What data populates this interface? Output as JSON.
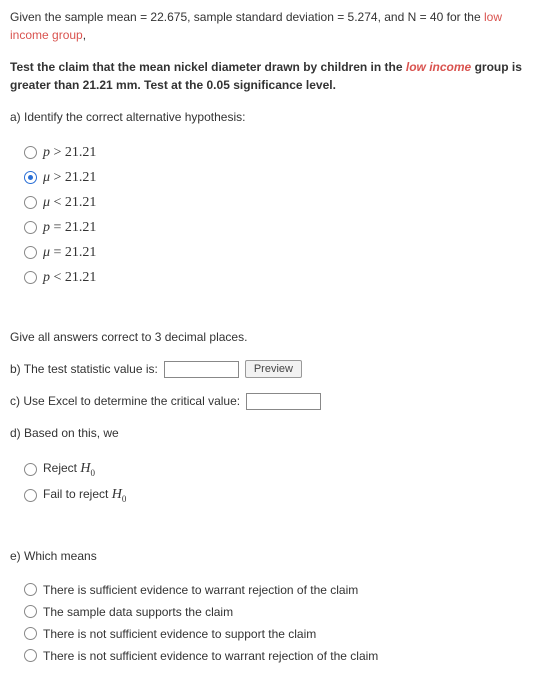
{
  "intro1_a": "Given the sample mean = 22.675, sample standard deviation = 5.274, and N = 40 for the ",
  "intro1_b": "low income group",
  "intro1_c": ",",
  "intro2_a": "Test the claim that the mean nickel diameter drawn by children in the ",
  "intro2_b": "low income",
  "intro2_c": " group is greater than 21.21 mm. Test at the 0.05 significance level.",
  "qa": "a) Identify the correct alternative hypothesis:",
  "opts_a": [
    {
      "sym": "p",
      "op": ">",
      "v": "21.21",
      "sel": false
    },
    {
      "sym": "μ",
      "op": ">",
      "v": "21.21",
      "sel": true
    },
    {
      "sym": "μ",
      "op": "<",
      "v": "21.21",
      "sel": false
    },
    {
      "sym": "p",
      "op": "=",
      "v": "21.21",
      "sel": false
    },
    {
      "sym": "μ",
      "op": "=",
      "v": "21.21",
      "sel": false
    },
    {
      "sym": "p",
      "op": "<",
      "v": "21.21",
      "sel": false
    }
  ],
  "note3dec": "Give all answers correct to 3 decimal places.",
  "qb": "b) The test statistic value is:",
  "preview": "Preview",
  "qc": "c) Use Excel to determine the critical value:",
  "qd": "d) Based on this, we",
  "opts_d": [
    {
      "t": "Reject ",
      "h": "H",
      "s": "0"
    },
    {
      "t": "Fail to reject ",
      "h": "H",
      "s": "0"
    }
  ],
  "qe": "e) Which means",
  "opts_e": [
    "There is sufficient evidence to warrant rejection of the claim",
    "The sample data supports the claim",
    "There is not sufficient evidence to support the claim",
    "There is not sufficient evidence to warrant rejection of the claim"
  ]
}
